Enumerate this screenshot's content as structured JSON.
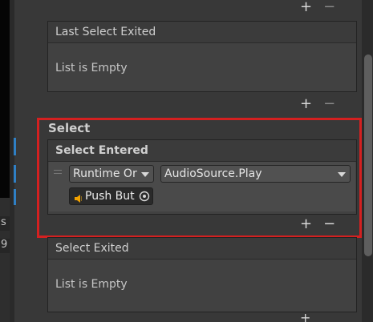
{
  "left_panel": {
    "row_glyphs": [
      "s",
      "9"
    ]
  },
  "last_select_exited": {
    "title": "Last Select Exited",
    "empty_label": "List is Empty",
    "add": "+",
    "remove": "−"
  },
  "select_section": {
    "label": "Select",
    "select_entered": {
      "title": "Select Entered",
      "runtime_dropdown": "Runtime Or",
      "function_dropdown": "AudioSource.Play",
      "object_field": "Push But",
      "add": "+",
      "remove": "−"
    }
  },
  "select_exited": {
    "title": "Select Exited",
    "empty_label": "List is Empty"
  },
  "top_controls": {
    "add": "+",
    "remove": "−"
  },
  "colors": {
    "highlight": "#d42020",
    "scroll_thumb": "#5e5e5e",
    "speaker_icon": "#f2a200",
    "accent_tick": "#2f80c5"
  }
}
